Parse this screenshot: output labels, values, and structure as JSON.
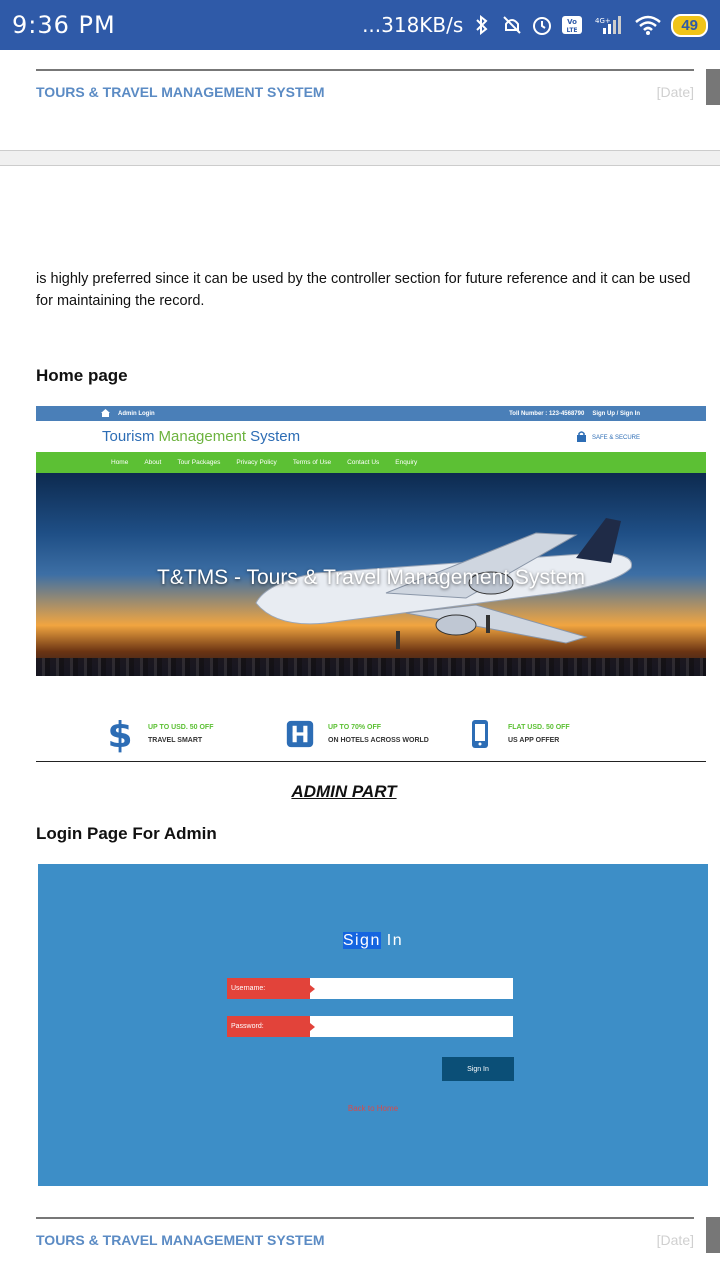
{
  "status_bar": {
    "time": "9:36 PM",
    "net_speed": "...318KB/s",
    "battery": "49",
    "lte_badge": "Vo LTE",
    "net_type": "4G+"
  },
  "header": {
    "title": "TOURS & TRAVEL MANAGEMENT SYSTEM",
    "date": "[Date]"
  },
  "body": {
    "paragraph": "is highly preferred since it can be used by the controller section for future reference and it can be used for maintaining the record.",
    "home_heading": "Home page",
    "admin_part": "ADMIN PART",
    "login_heading": "Login Page For Admin"
  },
  "home_screenshot": {
    "admin_login": "Admin Login",
    "toll_number": "Toll Number : 123-4568790",
    "signup": "Sign Up / Sign In",
    "brand_part1": "Tourism",
    "brand_part2": "Management",
    "brand_part3": "System",
    "safe": "SAFE & SECURE",
    "nav": [
      "Home",
      "About",
      "Tour Packages",
      "Privacy Policy",
      "Terms of Use",
      "Contact Us",
      "Enquiry"
    ],
    "hero_caption": "T&TMS - Tours & Travel Management System",
    "offers": [
      {
        "line1": "UP TO USD. 50 OFF",
        "line2": "TRAVEL SMART",
        "icon": "dollar-icon"
      },
      {
        "line1": "UP TO 70% OFF",
        "line2": "ON HOTELS ACROSS WORLD",
        "icon": "hotel-icon"
      },
      {
        "line1": "FLAT USD. 50 OFF",
        "line2": "US APP OFFER",
        "icon": "mobile-icon"
      }
    ]
  },
  "login_screenshot": {
    "title_sel": "Sign",
    "title_rest": " In",
    "username_label": "Username:",
    "password_label": "Password:",
    "signin_button": "Sign In",
    "back_link": "Back to Home"
  },
  "colors": {
    "status_bar": "#2f5aa8",
    "header_title": "#5b8bc4",
    "login_bg": "#3d8ec7",
    "nav_green": "#5cc034"
  }
}
